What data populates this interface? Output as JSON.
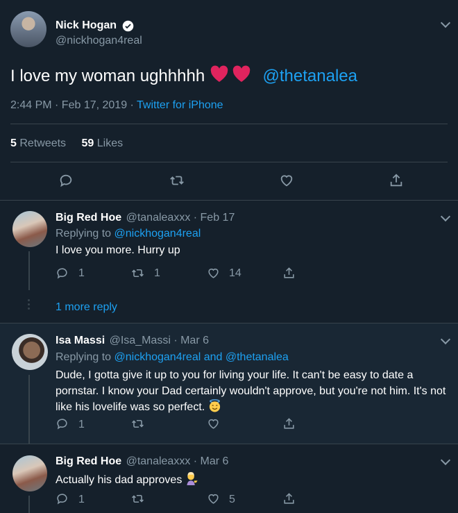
{
  "main": {
    "author_name": "Nick Hogan",
    "author_handle": "@nickhogan4real",
    "text": "I love my woman ughhhhh ",
    "mention": "@thetanalea",
    "time": "2:44 PM · Feb 17, 2019 · ",
    "source": "Twitter for iPhone",
    "retweets_count": "5",
    "retweets_label": "Retweets",
    "likes_count": "59",
    "likes_label": "Likes"
  },
  "replies": [
    {
      "name": "Big Red Hoe",
      "meta": "@tanaleaxxx · Feb 17",
      "replying_prefix": "Replying to ",
      "replying_to": "@nickhogan4real",
      "text": "I love you more. Hurry up",
      "reply_count": "1",
      "retweet_count": "1",
      "like_count": "14"
    },
    {
      "name": "Isa Massi",
      "meta": "@Isa_Massi · Mar 6",
      "replying_prefix": "Replying to ",
      "replying_to": "@nickhogan4real and @thetanalea",
      "text": "Dude, I gotta give it up to you for living your life. It can't be easy to date a pornstar. I know your Dad certainly wouldn't approve, but you're not him. It's not like his lovelife was so perfect. ",
      "reply_count": "1",
      "retweet_count": "",
      "like_count": ""
    },
    {
      "name": "Big Red Hoe",
      "meta": "@tanaleaxxx · Mar 6",
      "text": "Actually his dad approves ",
      "reply_count": "1",
      "retweet_count": "",
      "like_count": "5"
    }
  ],
  "more_replies": "1 more reply",
  "icons": [
    "chevron-down-icon",
    "verified-badge-icon",
    "heart-emoji-icon",
    "reply-icon",
    "retweet-icon",
    "like-icon",
    "share-icon",
    "halo-smile-emoji-icon",
    "tipping-hand-emoji-icon"
  ],
  "colors": {
    "background": "#15202b",
    "accent": "#1da1f2",
    "muted": "#8899a6",
    "divider": "#38444d",
    "selected_row": "#192734",
    "heart": "#e0245e"
  }
}
